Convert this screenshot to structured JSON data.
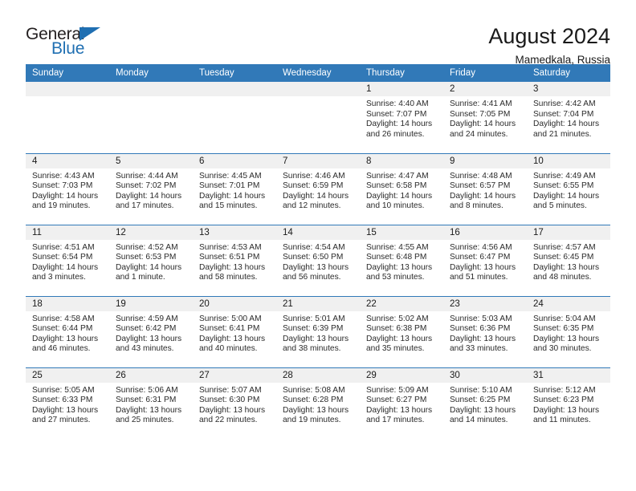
{
  "brand": {
    "name_part1": "General",
    "name_part2": "Blue",
    "flag_icon": "triangle-flag-icon",
    "accent_color": "#1f6fb2"
  },
  "header": {
    "month_title": "August 2024",
    "location": "Mamedkala, Russia"
  },
  "calendar": {
    "header_bg": "#3179b8",
    "daynum_band_bg": "#f0f0f0",
    "weekday_headers": [
      "Sunday",
      "Monday",
      "Tuesday",
      "Wednesday",
      "Thursday",
      "Friday",
      "Saturday"
    ],
    "weeks": [
      [
        {
          "day": "",
          "sunrise": "",
          "sunset": "",
          "daylight_line1": "",
          "daylight_line2": ""
        },
        {
          "day": "",
          "sunrise": "",
          "sunset": "",
          "daylight_line1": "",
          "daylight_line2": ""
        },
        {
          "day": "",
          "sunrise": "",
          "sunset": "",
          "daylight_line1": "",
          "daylight_line2": ""
        },
        {
          "day": "",
          "sunrise": "",
          "sunset": "",
          "daylight_line1": "",
          "daylight_line2": ""
        },
        {
          "day": "1",
          "sunrise": "Sunrise: 4:40 AM",
          "sunset": "Sunset: 7:07 PM",
          "daylight_line1": "Daylight: 14 hours",
          "daylight_line2": "and 26 minutes."
        },
        {
          "day": "2",
          "sunrise": "Sunrise: 4:41 AM",
          "sunset": "Sunset: 7:05 PM",
          "daylight_line1": "Daylight: 14 hours",
          "daylight_line2": "and 24 minutes."
        },
        {
          "day": "3",
          "sunrise": "Sunrise: 4:42 AM",
          "sunset": "Sunset: 7:04 PM",
          "daylight_line1": "Daylight: 14 hours",
          "daylight_line2": "and 21 minutes."
        }
      ],
      [
        {
          "day": "4",
          "sunrise": "Sunrise: 4:43 AM",
          "sunset": "Sunset: 7:03 PM",
          "daylight_line1": "Daylight: 14 hours",
          "daylight_line2": "and 19 minutes."
        },
        {
          "day": "5",
          "sunrise": "Sunrise: 4:44 AM",
          "sunset": "Sunset: 7:02 PM",
          "daylight_line1": "Daylight: 14 hours",
          "daylight_line2": "and 17 minutes."
        },
        {
          "day": "6",
          "sunrise": "Sunrise: 4:45 AM",
          "sunset": "Sunset: 7:01 PM",
          "daylight_line1": "Daylight: 14 hours",
          "daylight_line2": "and 15 minutes."
        },
        {
          "day": "7",
          "sunrise": "Sunrise: 4:46 AM",
          "sunset": "Sunset: 6:59 PM",
          "daylight_line1": "Daylight: 14 hours",
          "daylight_line2": "and 12 minutes."
        },
        {
          "day": "8",
          "sunrise": "Sunrise: 4:47 AM",
          "sunset": "Sunset: 6:58 PM",
          "daylight_line1": "Daylight: 14 hours",
          "daylight_line2": "and 10 minutes."
        },
        {
          "day": "9",
          "sunrise": "Sunrise: 4:48 AM",
          "sunset": "Sunset: 6:57 PM",
          "daylight_line1": "Daylight: 14 hours",
          "daylight_line2": "and 8 minutes."
        },
        {
          "day": "10",
          "sunrise": "Sunrise: 4:49 AM",
          "sunset": "Sunset: 6:55 PM",
          "daylight_line1": "Daylight: 14 hours",
          "daylight_line2": "and 5 minutes."
        }
      ],
      [
        {
          "day": "11",
          "sunrise": "Sunrise: 4:51 AM",
          "sunset": "Sunset: 6:54 PM",
          "daylight_line1": "Daylight: 14 hours",
          "daylight_line2": "and 3 minutes."
        },
        {
          "day": "12",
          "sunrise": "Sunrise: 4:52 AM",
          "sunset": "Sunset: 6:53 PM",
          "daylight_line1": "Daylight: 14 hours",
          "daylight_line2": "and 1 minute."
        },
        {
          "day": "13",
          "sunrise": "Sunrise: 4:53 AM",
          "sunset": "Sunset: 6:51 PM",
          "daylight_line1": "Daylight: 13 hours",
          "daylight_line2": "and 58 minutes."
        },
        {
          "day": "14",
          "sunrise": "Sunrise: 4:54 AM",
          "sunset": "Sunset: 6:50 PM",
          "daylight_line1": "Daylight: 13 hours",
          "daylight_line2": "and 56 minutes."
        },
        {
          "day": "15",
          "sunrise": "Sunrise: 4:55 AM",
          "sunset": "Sunset: 6:48 PM",
          "daylight_line1": "Daylight: 13 hours",
          "daylight_line2": "and 53 minutes."
        },
        {
          "day": "16",
          "sunrise": "Sunrise: 4:56 AM",
          "sunset": "Sunset: 6:47 PM",
          "daylight_line1": "Daylight: 13 hours",
          "daylight_line2": "and 51 minutes."
        },
        {
          "day": "17",
          "sunrise": "Sunrise: 4:57 AM",
          "sunset": "Sunset: 6:45 PM",
          "daylight_line1": "Daylight: 13 hours",
          "daylight_line2": "and 48 minutes."
        }
      ],
      [
        {
          "day": "18",
          "sunrise": "Sunrise: 4:58 AM",
          "sunset": "Sunset: 6:44 PM",
          "daylight_line1": "Daylight: 13 hours",
          "daylight_line2": "and 46 minutes."
        },
        {
          "day": "19",
          "sunrise": "Sunrise: 4:59 AM",
          "sunset": "Sunset: 6:42 PM",
          "daylight_line1": "Daylight: 13 hours",
          "daylight_line2": "and 43 minutes."
        },
        {
          "day": "20",
          "sunrise": "Sunrise: 5:00 AM",
          "sunset": "Sunset: 6:41 PM",
          "daylight_line1": "Daylight: 13 hours",
          "daylight_line2": "and 40 minutes."
        },
        {
          "day": "21",
          "sunrise": "Sunrise: 5:01 AM",
          "sunset": "Sunset: 6:39 PM",
          "daylight_line1": "Daylight: 13 hours",
          "daylight_line2": "and 38 minutes."
        },
        {
          "day": "22",
          "sunrise": "Sunrise: 5:02 AM",
          "sunset": "Sunset: 6:38 PM",
          "daylight_line1": "Daylight: 13 hours",
          "daylight_line2": "and 35 minutes."
        },
        {
          "day": "23",
          "sunrise": "Sunrise: 5:03 AM",
          "sunset": "Sunset: 6:36 PM",
          "daylight_line1": "Daylight: 13 hours",
          "daylight_line2": "and 33 minutes."
        },
        {
          "day": "24",
          "sunrise": "Sunrise: 5:04 AM",
          "sunset": "Sunset: 6:35 PM",
          "daylight_line1": "Daylight: 13 hours",
          "daylight_line2": "and 30 minutes."
        }
      ],
      [
        {
          "day": "25",
          "sunrise": "Sunrise: 5:05 AM",
          "sunset": "Sunset: 6:33 PM",
          "daylight_line1": "Daylight: 13 hours",
          "daylight_line2": "and 27 minutes."
        },
        {
          "day": "26",
          "sunrise": "Sunrise: 5:06 AM",
          "sunset": "Sunset: 6:31 PM",
          "daylight_line1": "Daylight: 13 hours",
          "daylight_line2": "and 25 minutes."
        },
        {
          "day": "27",
          "sunrise": "Sunrise: 5:07 AM",
          "sunset": "Sunset: 6:30 PM",
          "daylight_line1": "Daylight: 13 hours",
          "daylight_line2": "and 22 minutes."
        },
        {
          "day": "28",
          "sunrise": "Sunrise: 5:08 AM",
          "sunset": "Sunset: 6:28 PM",
          "daylight_line1": "Daylight: 13 hours",
          "daylight_line2": "and 19 minutes."
        },
        {
          "day": "29",
          "sunrise": "Sunrise: 5:09 AM",
          "sunset": "Sunset: 6:27 PM",
          "daylight_line1": "Daylight: 13 hours",
          "daylight_line2": "and 17 minutes."
        },
        {
          "day": "30",
          "sunrise": "Sunrise: 5:10 AM",
          "sunset": "Sunset: 6:25 PM",
          "daylight_line1": "Daylight: 13 hours",
          "daylight_line2": "and 14 minutes."
        },
        {
          "day": "31",
          "sunrise": "Sunrise: 5:12 AM",
          "sunset": "Sunset: 6:23 PM",
          "daylight_line1": "Daylight: 13 hours",
          "daylight_line2": "and 11 minutes."
        }
      ]
    ]
  }
}
